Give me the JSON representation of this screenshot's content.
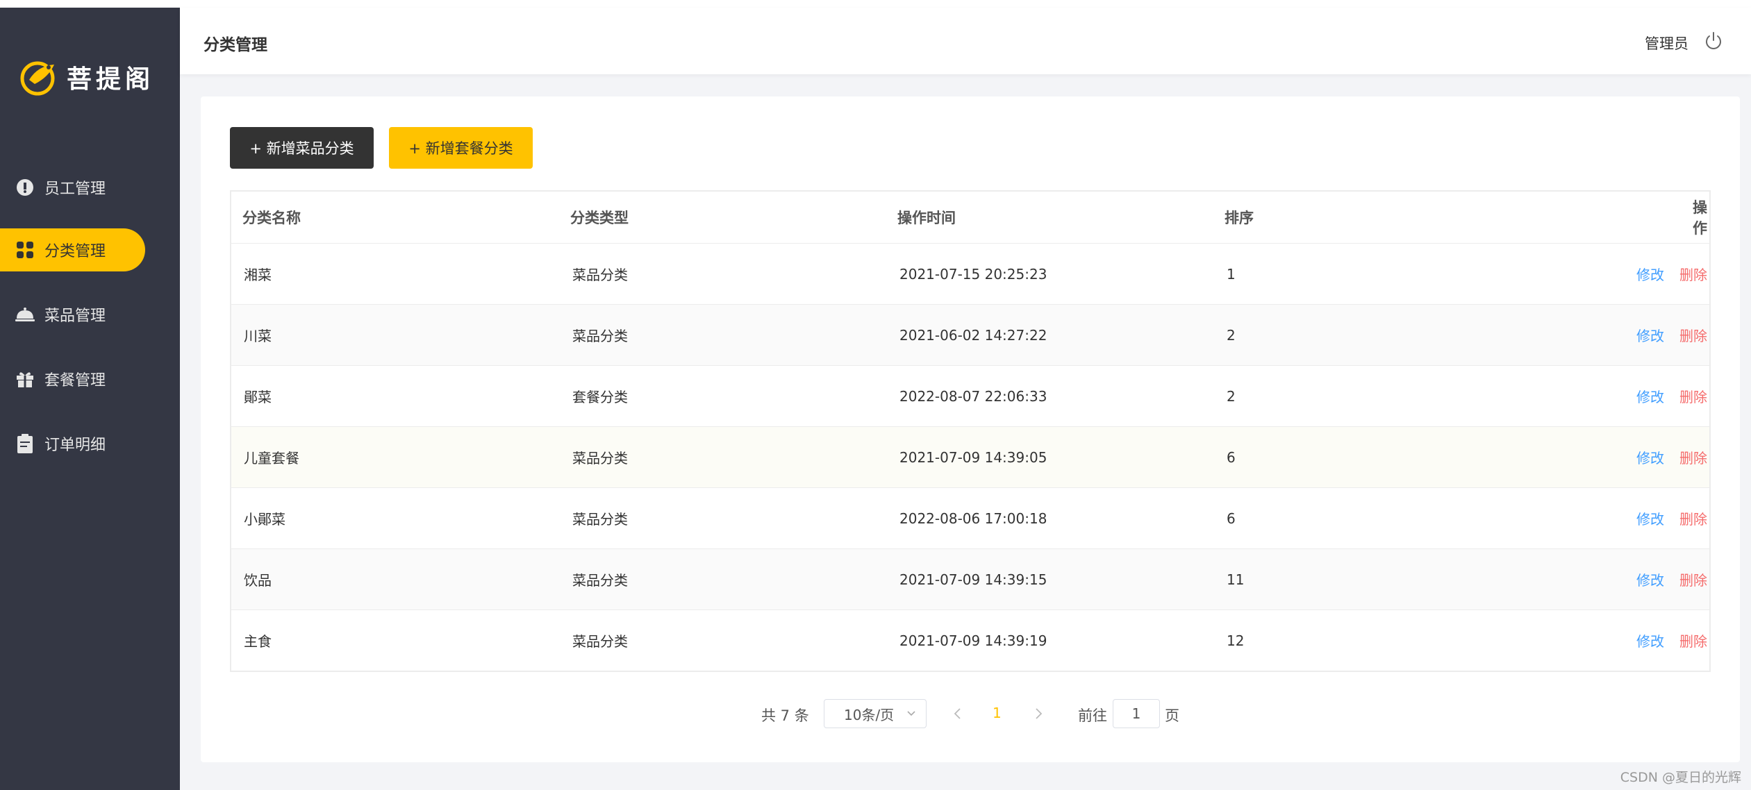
{
  "brand": {
    "name": "菩提阁",
    "accent": "#ffc200",
    "sidebar_bg": "#343744"
  },
  "sidebar": {
    "items": [
      {
        "label": "员工管理",
        "icon": "employee-icon",
        "active": false
      },
      {
        "label": "分类管理",
        "icon": "category-grid-icon",
        "active": true
      },
      {
        "label": "菜品管理",
        "icon": "dish-cloche-icon",
        "active": false
      },
      {
        "label": "套餐管理",
        "icon": "gift-icon",
        "active": false
      },
      {
        "label": "订单明细",
        "icon": "clipboard-icon",
        "active": false
      }
    ]
  },
  "header": {
    "title": "分类管理",
    "user": "管理员"
  },
  "toolbar": {
    "add_dish_category": "+ 新增菜品分类",
    "add_combo_category": "+ 新增套餐分类"
  },
  "table": {
    "columns": [
      "分类名称",
      "分类类型",
      "操作时间",
      "排序",
      "操作"
    ],
    "rows": [
      {
        "name": "湘菜",
        "type": "菜品分类",
        "time": "2021-07-15 20:25:23",
        "sort": "1"
      },
      {
        "name": "川菜",
        "type": "菜品分类",
        "time": "2021-06-02 14:27:22",
        "sort": "2"
      },
      {
        "name": "鄖菜",
        "type": "套餐分类",
        "time": "2022-08-07 22:06:33",
        "sort": "2"
      },
      {
        "name": "儿童套餐",
        "type": "菜品分类",
        "time": "2021-07-09 14:39:05",
        "sort": "6"
      },
      {
        "name": "小鄖菜",
        "type": "菜品分类",
        "time": "2022-08-06 17:00:18",
        "sort": "6"
      },
      {
        "name": "饮品",
        "type": "菜品分类",
        "time": "2021-07-09 14:39:15",
        "sort": "11"
      },
      {
        "name": "主食",
        "type": "菜品分类",
        "time": "2021-07-09 14:39:19",
        "sort": "12"
      }
    ],
    "edit_label": "修改",
    "delete_label": "删除",
    "colors": {
      "edit": "#419eff",
      "delete": "#f56c6c"
    }
  },
  "pagination": {
    "total_text": "共 7 条",
    "page_size": "10条/页",
    "current_page": "1",
    "goto_label": "前往",
    "goto_value": "1",
    "page_suffix": "页"
  },
  "watermark": "CSDN @夏日的光辉"
}
